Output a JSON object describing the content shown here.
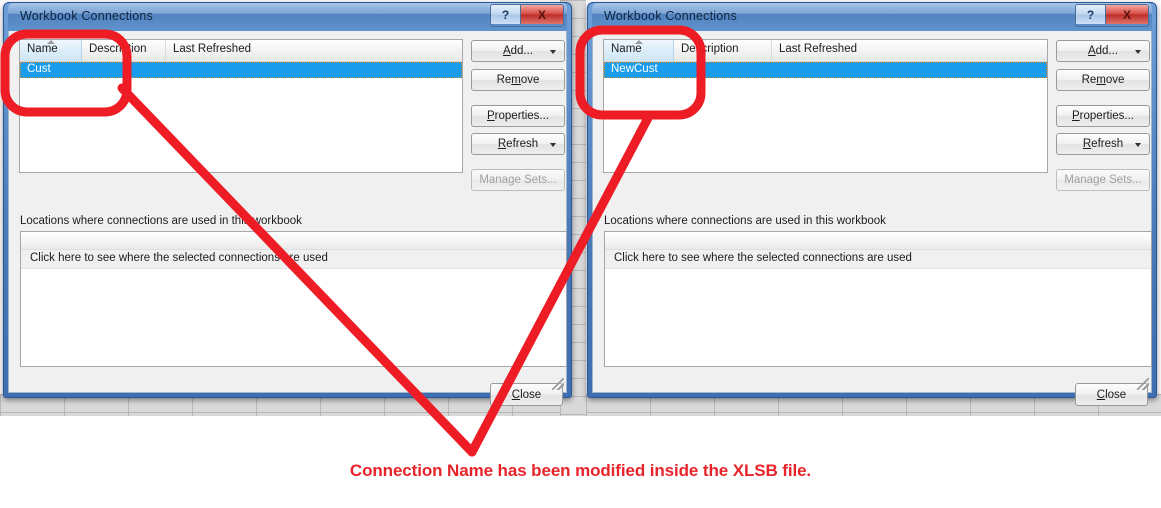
{
  "window_title": "Workbook Connections",
  "titlebar": {
    "help_label": "?",
    "close_label": "X"
  },
  "columns": [
    "Name",
    "Description",
    "Last Refreshed"
  ],
  "dialogs": [
    {
      "id": "left",
      "title": "Workbook Connections",
      "selected_connection": "Cust"
    },
    {
      "id": "right",
      "title": "Workbook Connections",
      "selected_connection": "NewCust"
    }
  ],
  "buttons": {
    "add": "Add...",
    "remove": "Remove",
    "properties": "Properties...",
    "refresh": "Refresh",
    "manage_sets": "Manage Sets...",
    "close": "Close"
  },
  "locations": {
    "label": "Locations where connections are used in this workbook",
    "hint_row": "Click here to see where the selected connections are used"
  },
  "annotation": {
    "caption": "Connection Name has been modified inside the XLSB file.",
    "color": "#e8232a"
  }
}
